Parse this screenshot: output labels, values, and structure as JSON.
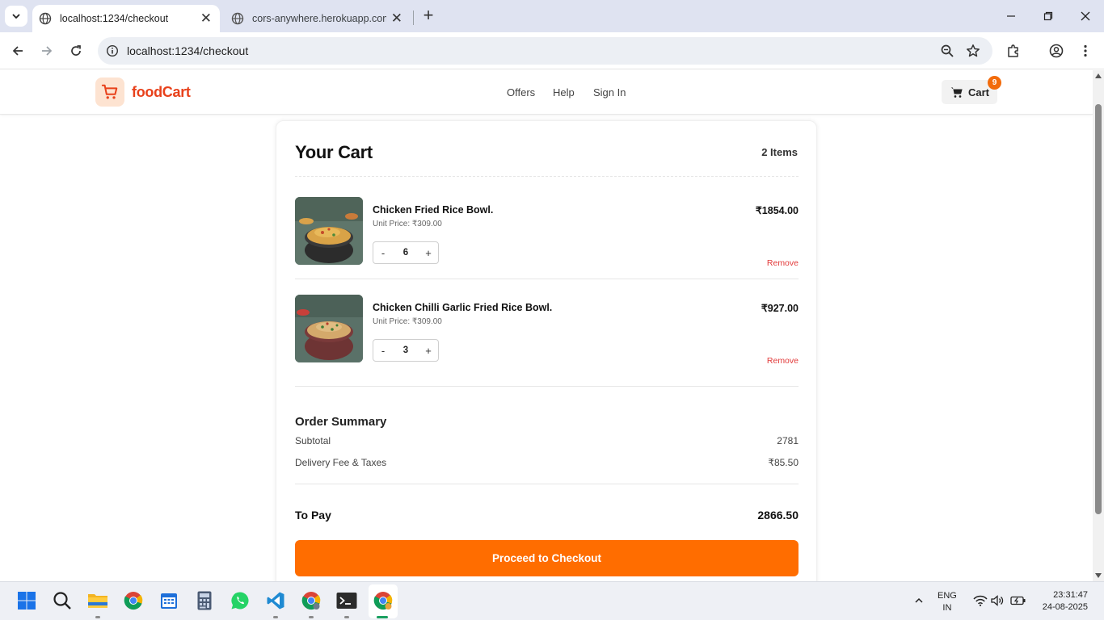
{
  "browser": {
    "tabs": [
      {
        "title": "localhost:1234/checkout",
        "active": true
      },
      {
        "title": "cors-anywhere.herokuapp.com/",
        "active": false
      }
    ],
    "url": "localhost:1234/checkout"
  },
  "header": {
    "brand": "foodCart",
    "nav": [
      "Offers",
      "Help",
      "Sign In"
    ],
    "cart_label": "Cart",
    "cart_badge": "9"
  },
  "cart": {
    "title": "Your Cart",
    "count_label": "2 Items",
    "items": [
      {
        "name": "Chicken Fried Rice Bowl.",
        "unit_price": "Unit Price: ₹309.00",
        "quantity": "6",
        "total": "₹1854.00",
        "remove_label": "Remove",
        "dec_label": "-",
        "inc_label": "+"
      },
      {
        "name": "Chicken Chilli Garlic Fried Rice Bowl.",
        "unit_price": "Unit Price: ₹309.00",
        "quantity": "3",
        "total": "₹927.00",
        "remove_label": "Remove",
        "dec_label": "-",
        "inc_label": "+"
      }
    ]
  },
  "summary": {
    "title": "Order Summary",
    "subtotal_label": "Subtotal",
    "subtotal_value": "2781",
    "fee_label": "Delivery Fee & Taxes",
    "fee_value": "₹85.50",
    "to_pay_label": "To Pay",
    "to_pay_value": "2866.50",
    "checkout_label": "Proceed to Checkout"
  },
  "taskbar": {
    "lang_top": "ENG",
    "lang_bottom": "IN",
    "time": "23:31:47",
    "date": "24-08-2025"
  },
  "colors": {
    "accent": "#ff6d00",
    "brand": "#e8411b",
    "remove": "#e23a3a"
  }
}
